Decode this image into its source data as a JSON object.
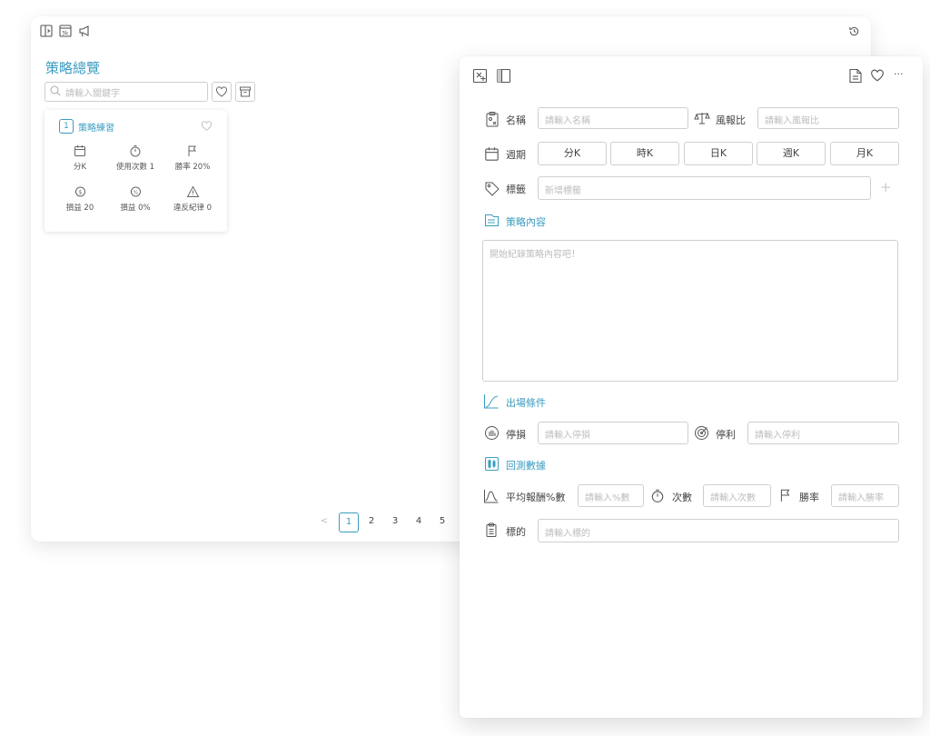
{
  "back_panel": {
    "title": "策略總覽",
    "search_placeholder": "請輸入關鍵字",
    "card": {
      "index": "1",
      "title": "策略練習",
      "stats": [
        {
          "icon": "calendar-icon",
          "label": "分K"
        },
        {
          "icon": "stopwatch-icon",
          "label": "使用次數 1"
        },
        {
          "icon": "flag-icon",
          "label": "勝率 20%"
        },
        {
          "icon": "coin-icon",
          "label": "損益 20"
        },
        {
          "icon": "percent-coin-icon",
          "label": "損益 0%"
        },
        {
          "icon": "warning-icon",
          "label": "違反紀律 0"
        }
      ]
    },
    "pagination": {
      "prev": "<",
      "pages": [
        "1",
        "2",
        "3",
        "4",
        "5"
      ],
      "current": "1"
    }
  },
  "front_panel": {
    "name_label": "名稱",
    "name_placeholder": "請輸入名稱",
    "rr_label": "風報比",
    "rr_placeholder": "請輸入風報比",
    "period_label": "週期",
    "periods": [
      "分K",
      "時K",
      "日K",
      "週K",
      "月K"
    ],
    "tag_label": "標籤",
    "tag_placeholder": "新增標籤",
    "tag_add": "+",
    "content_section": "策略內容",
    "content_placeholder": "開始紀錄策略內容吧！",
    "exit_section": "出場條件",
    "stoploss_label": "停損",
    "stoploss_placeholder": "請輸入停損",
    "takeprofit_label": "停利",
    "takeprofit_placeholder": "請輸入停利",
    "backtest_section": "回測數據",
    "avg_return_label": "平均報酬%數",
    "avg_return_placeholder": "請輸入%數",
    "count_label": "次數",
    "count_placeholder": "請輸入次數",
    "winrate_label": "勝率",
    "winrate_placeholder": "請輸入勝率",
    "target_label": "標的",
    "target_placeholder": "請輸入標的",
    "more": "···"
  },
  "colors": {
    "accent": "#3b9cbf",
    "border": "#cfcfcf",
    "placeholder": "#bdbdbd"
  }
}
